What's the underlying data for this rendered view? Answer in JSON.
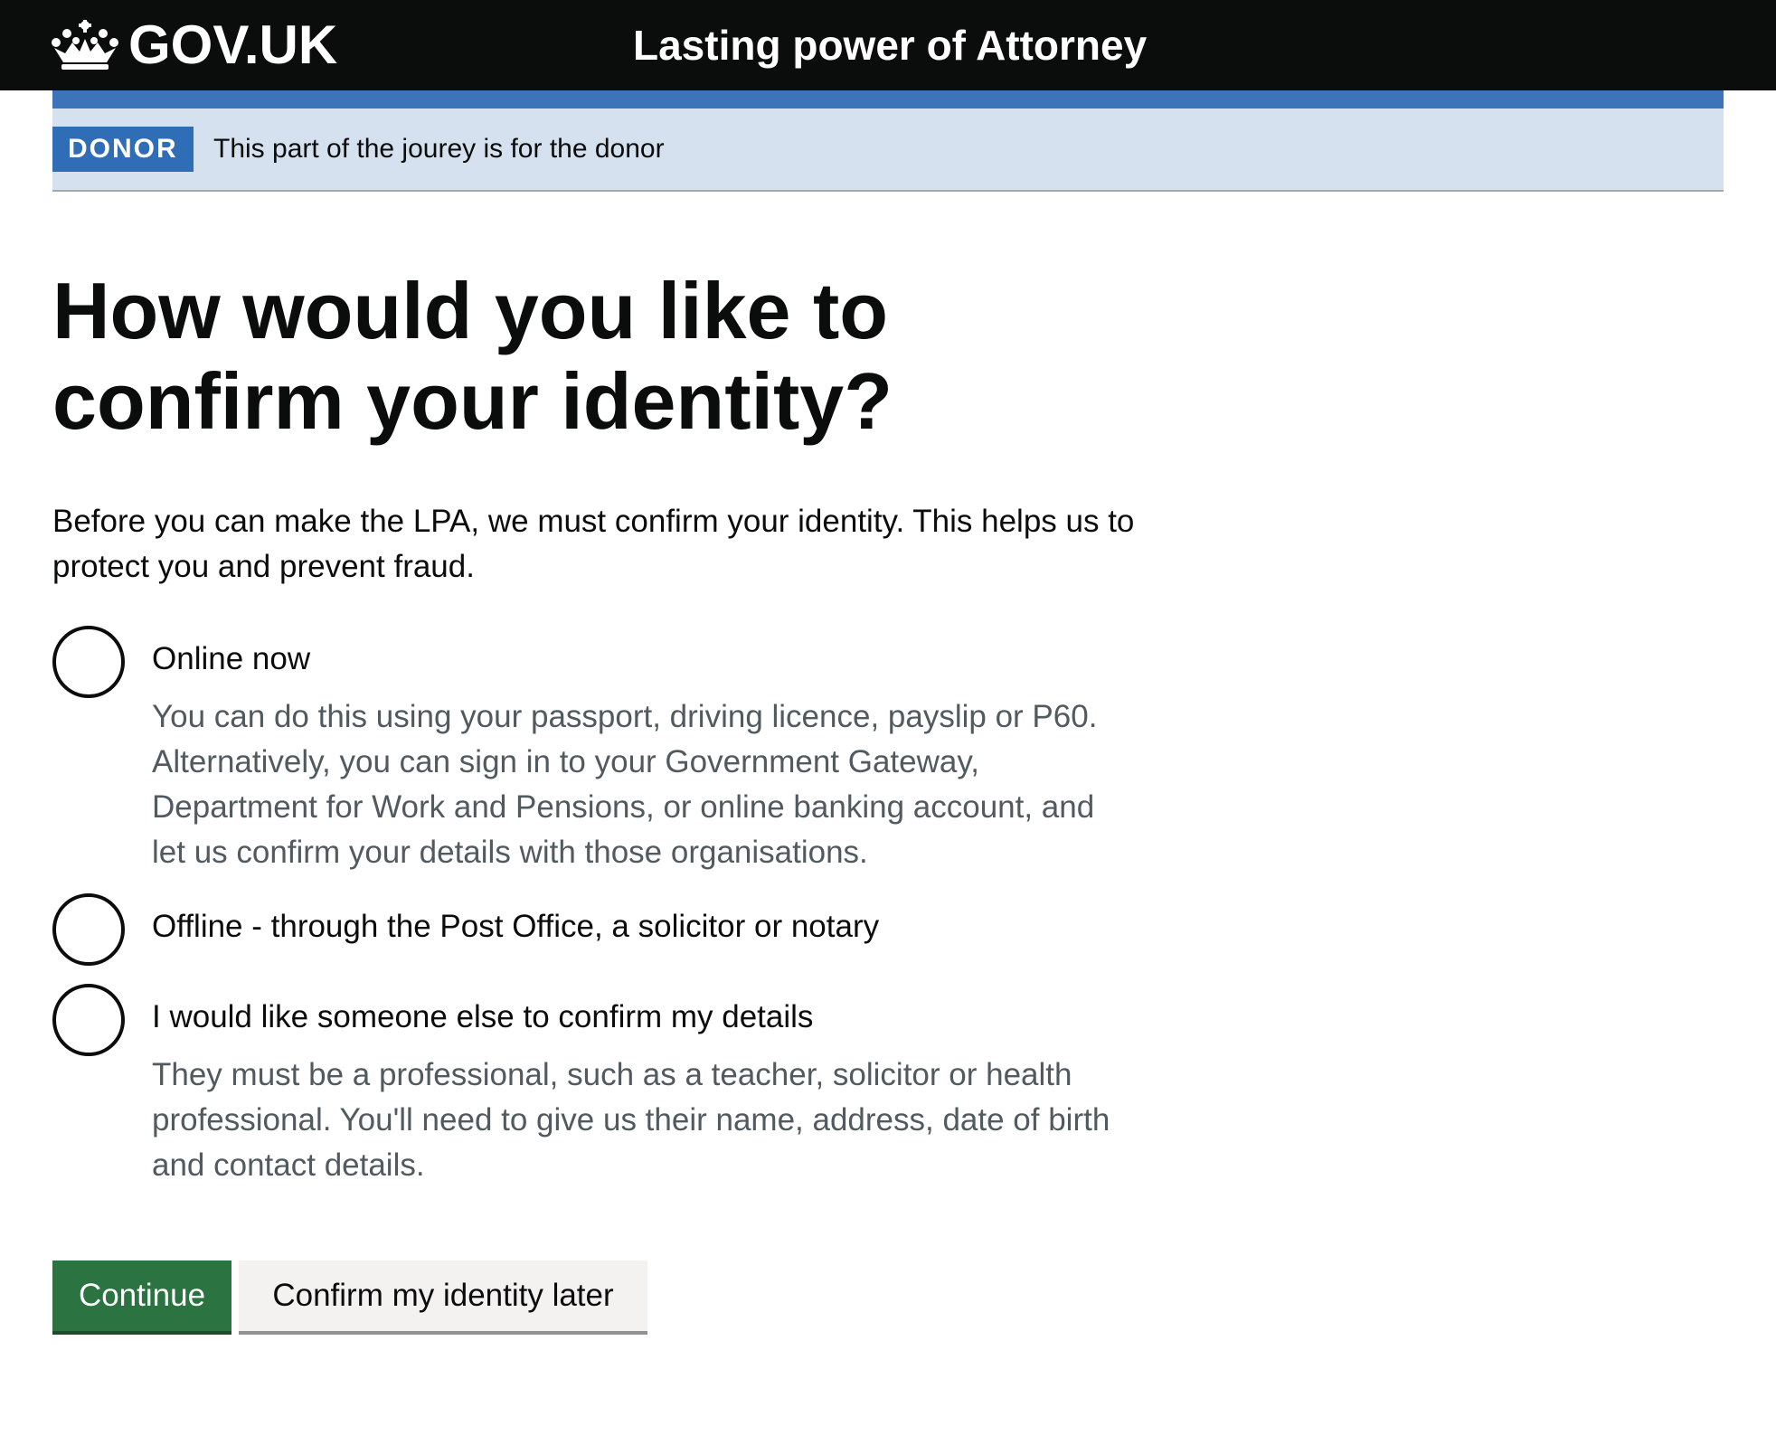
{
  "header": {
    "logo_text": "GOV.UK",
    "service_name": "Lasting power of Attorney"
  },
  "banner": {
    "tag": "DONOR",
    "text": "This part of the jourey is for the donor"
  },
  "main": {
    "heading": "How would you like to confirm your identity?",
    "intro": "Before you can make the LPA, we must confirm your identity. This helps us to protect you and prevent fraud.",
    "options": [
      {
        "label": "Online now",
        "hint": "You can do this using your passport, driving licence, payslip or P60. Alternatively, you can sign in to your Government Gateway, Department for Work and Pensions, or online banking account, and let us confirm your details with those organisations.",
        "selected": false
      },
      {
        "label": "Offline - through the Post Office, a solicitor or notary",
        "selected": false
      },
      {
        "label": "I would like someone else to confirm my details",
        "hint": "They must be a professional, such as a teacher, solicitor or health professional. You'll need to give us their name, address, date of birth and contact details.",
        "selected": false
      }
    ],
    "continue_label": "Continue",
    "later_label": "Confirm my identity later"
  },
  "colors": {
    "header_bg": "#0b0c0c",
    "banner_bar": "#3d73b8",
    "banner_bg": "#d5e1ee",
    "tag_bg": "#2f6eb6",
    "primary_button": "#2b7340",
    "secondary_button": "#f3f2f1",
    "hint_text": "#505a5f"
  },
  "icons": {
    "logo": "crown-icon"
  }
}
